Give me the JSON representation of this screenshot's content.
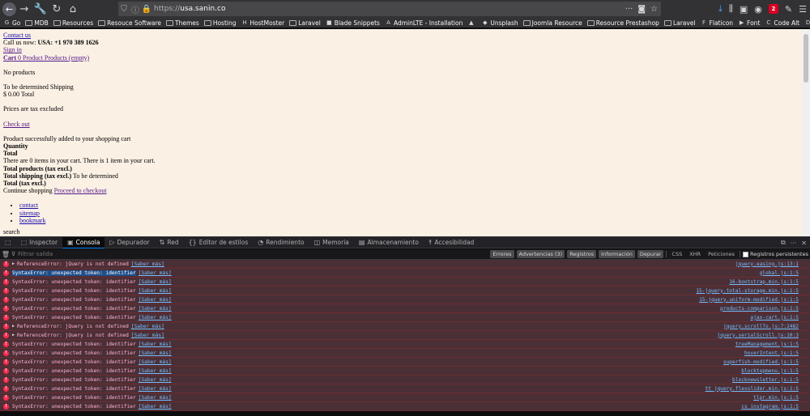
{
  "browser": {
    "url_prefix": "https://",
    "url_host": "usa.sanin.co",
    "url_more": "···",
    "nav_icons": [
      "back-icon",
      "forward-icon",
      "wrench-icon",
      "reload-icon",
      "home-icon"
    ],
    "bookmarks": [
      {
        "label": "Go",
        "icon": "google-icon"
      },
      {
        "label": "MDB",
        "icon": "folder-icon"
      },
      {
        "label": "Resources",
        "icon": "folder-icon"
      },
      {
        "label": "Resouce Software",
        "icon": "folder-icon"
      },
      {
        "label": "Themes",
        "icon": "folder-icon"
      },
      {
        "label": "Hosting",
        "icon": "folder-icon"
      },
      {
        "label": "HostMoster",
        "icon": "hm-icon"
      },
      {
        "label": "Laravel",
        "icon": "folder-icon"
      },
      {
        "label": "Blade Snippets",
        "icon": "blade-icon"
      },
      {
        "label": "AdminLTE - Installation",
        "icon": "adminlte-icon"
      },
      {
        "label": "",
        "icon": "em-icon"
      },
      {
        "label": "Unsplash",
        "icon": "unsplash-icon"
      },
      {
        "label": "Joomla Resource",
        "icon": "folder-icon"
      },
      {
        "label": "Resource Prestashop",
        "icon": "folder-icon"
      },
      {
        "label": "Laravel",
        "icon": "folder-icon"
      },
      {
        "label": "Flaticon",
        "icon": "flaticon-icon"
      },
      {
        "label": "Font",
        "icon": "font-icon"
      },
      {
        "label": "Code Alt",
        "icon": "code-icon"
      },
      {
        "label": "DNS",
        "icon": "dns-icon"
      },
      {
        "label": "Whois",
        "icon": "folder-icon"
      },
      {
        "label": "IP Location",
        "icon": "ip-icon"
      },
      {
        "label": "Htaccess Tools",
        "icon": "globe-icon"
      }
    ]
  },
  "page": {
    "contact_us": "Contact us",
    "call_us_prefix": "Call us now: ",
    "call_us_number": "USA: +1 970 389 1626",
    "sign_in": "Sign in",
    "cart_label": "Cart",
    "cart_status": "0 Product Products (empty)",
    "no_products": "No products",
    "shipping": "To be determined Shipping",
    "total": "$ 0.00 Total",
    "tax_note": "Prices are tax excluded",
    "check_out": "Check out",
    "added_msg": "Product successfully added to your shopping cart",
    "quantity": "Quantity",
    "total_label": "Total",
    "items_msg": "There are 0 items in your cart. There is 1 item in your cart.",
    "total_products": "Total products (tax excl.)",
    "total_shipping": "Total shipping (tax excl.)",
    "total_shipping_value": " To be determined",
    "total_tax": "Total (tax excl.)",
    "continue_shopping": "Continue shopping",
    "proceed_checkout": "Proceed to checkout",
    "footer_links": [
      "contact",
      "sitemap",
      "bookmark"
    ],
    "search": "search"
  },
  "devtools": {
    "tabs": [
      {
        "label": "Inspector",
        "icon": "inspector-icon"
      },
      {
        "label": "Consola",
        "icon": "console-icon",
        "active": true
      },
      {
        "label": "Depurador",
        "icon": "debugger-icon"
      },
      {
        "label": "Red",
        "icon": "network-icon"
      },
      {
        "label": "Editor de estilos",
        "icon": "style-editor-icon"
      },
      {
        "label": "Rendimiento",
        "icon": "performance-icon"
      },
      {
        "label": "Memoria",
        "icon": "memory-icon"
      },
      {
        "label": "Almacenamiento",
        "icon": "storage-icon"
      },
      {
        "label": "Accesibilidad",
        "icon": "accessibility-icon"
      }
    ],
    "filter_placeholder": "Filtrar salida",
    "filter_buttons": [
      {
        "label": "Errores",
        "on": true
      },
      {
        "label": "Advertencias (3)",
        "on": true
      },
      {
        "label": "Registros",
        "on": true
      },
      {
        "label": "Información",
        "on": true
      },
      {
        "label": "Depurar",
        "on": true
      }
    ],
    "type_buttons": [
      "CSS",
      "XHR",
      "Peticiones"
    ],
    "persist_label": "Registros persistentes",
    "more_label": "[Saber más]",
    "messages": [
      {
        "text": "ReferenceError: jQuery is not defined",
        "source": "jquery.easing.js:13:1",
        "twisty": true
      },
      {
        "text": "SyntaxError: unexpected token: identifier",
        "source": "global.js:1:5",
        "selected": true
      },
      {
        "text": "SyntaxError: unexpected token: identifier",
        "source": "16-bootstrap.min.js:1:5"
      },
      {
        "text": "SyntaxError: unexpected token: identifier",
        "source": "15-jquery.total-storage.min.js:1:5"
      },
      {
        "text": "SyntaxError: unexpected token: identifier",
        "source": "15-jquery.uniform-modified.js:1:5"
      },
      {
        "text": "SyntaxError: unexpected token: identifier",
        "source": "products-comparison.js:1:5"
      },
      {
        "text": "SyntaxError: unexpected token: identifier",
        "source": "ajax-cart.js:1:5"
      },
      {
        "text": "ReferenceError: jQuery is not defined",
        "source": "jquery.scrollTo.js:7:2482",
        "twisty": true
      },
      {
        "text": "ReferenceError: jQuery is not defined",
        "source": "jquery.serialScroll.js:10:3",
        "twisty": true
      },
      {
        "text": "SyntaxError: unexpected token: identifier",
        "source": "treeManagement.js:1:5"
      },
      {
        "text": "SyntaxError: unexpected token: identifier",
        "source": "hoverIntent.js:1:5"
      },
      {
        "text": "SyntaxError: unexpected token: identifier",
        "source": "superfish-modified.js:1:5"
      },
      {
        "text": "SyntaxError: unexpected token: identifier",
        "source": "blocktopmenu.js:1:5"
      },
      {
        "text": "SyntaxError: unexpected token: identifier",
        "source": "blocknewsletter.js:1:5"
      },
      {
        "text": "SyntaxError: unexpected token: identifier",
        "source": "tt_jquery.flexslider.min.js:1:5"
      },
      {
        "text": "SyntaxError: unexpected token: identifier",
        "source": "tlpr.min.js:1:5"
      },
      {
        "text": "SyntaxError: unexpected token: identifier",
        "source": "cs_instagram.js:1:5"
      }
    ]
  }
}
